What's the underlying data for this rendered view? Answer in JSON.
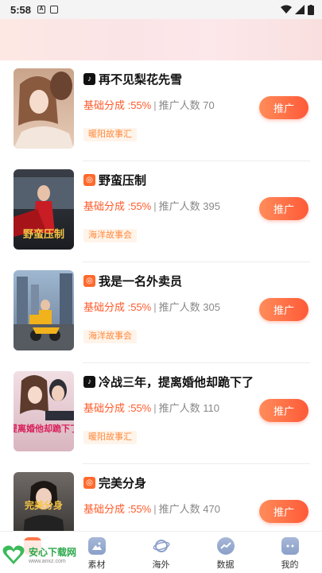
{
  "status_bar": {
    "time": "5:58"
  },
  "list_items": [
    {
      "title": "再不见梨花先雪",
      "platform": "douyin-icon",
      "share_label": "基础分成 :55%",
      "sep": "|",
      "count_label": "推广人数 70",
      "tag": "暖阳故事汇",
      "button": "推广"
    },
    {
      "title": "野蛮压制",
      "platform": "kuaishou-icon",
      "share_label": "基础分成 :55%",
      "sep": "|",
      "count_label": "推广人数 395",
      "tag": "海洋故事会",
      "button": "推广"
    },
    {
      "title": "我是一名外卖员",
      "platform": "kuaishou-icon",
      "share_label": "基础分成 :55%",
      "sep": "|",
      "count_label": "推广人数 305",
      "tag": "海洋故事会",
      "button": "推广"
    },
    {
      "title": "冷战三年，提离婚他却跪下了",
      "platform": "douyin-icon",
      "share_label": "基础分成 :55%",
      "sep": "|",
      "count_label": "推广人数 110",
      "tag": "暖阳故事汇",
      "button": "推广"
    },
    {
      "title": "完美分身",
      "platform": "kuaishou-icon",
      "share_label": "基础分成 :55%",
      "sep": "|",
      "count_label": "推广人数 470",
      "tag": "",
      "button": "推广"
    }
  ],
  "covers": [
    {
      "text": ""
    },
    {
      "text": "野蛮压制"
    },
    {
      "text": ""
    },
    {
      "text": "提离婚他却跪下了"
    },
    {
      "text": "完美分身"
    }
  ],
  "bottom_nav": [
    {
      "label": ""
    },
    {
      "label": "素材"
    },
    {
      "label": "海外"
    },
    {
      "label": "数据"
    },
    {
      "label": "我的"
    }
  ],
  "watermark": {
    "title": "安心下载网",
    "url": "www.anxz.com"
  },
  "colors": {
    "accent": "#ff5a2a",
    "tag_bg": "#fff4ea",
    "tag_text": "#ff8a3d"
  }
}
